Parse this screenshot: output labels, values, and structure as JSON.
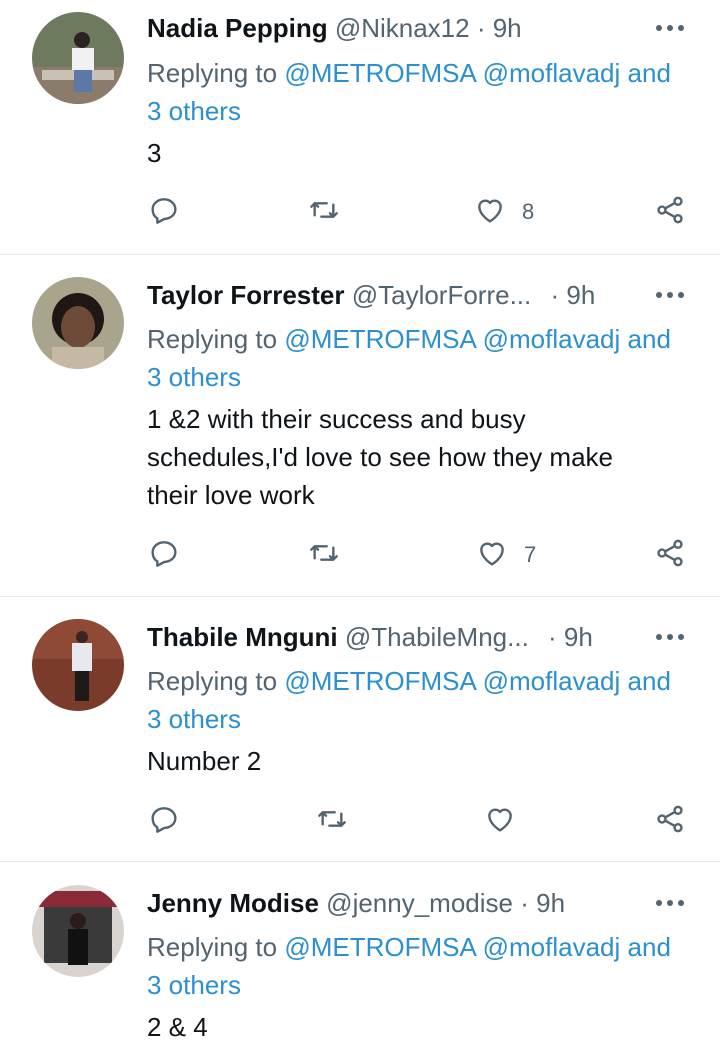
{
  "replies": [
    {
      "name": "Nadia Pepping",
      "handle": "@Niknax12",
      "time": "· 9h",
      "replying_prefix": "Replying to",
      "mention1": "@METROFMSA",
      "mention2": "@moflavadj",
      "others": "and 3 others",
      "text": "3",
      "like_count": "8"
    },
    {
      "name": "Taylor Forrester",
      "handle": "@TaylorForre...",
      "time": "· 9h",
      "replying_prefix": "Replying to",
      "mention1": "@METROFMSA",
      "mention2": "@moflavadj",
      "others": "and 3 others",
      "text": "1 &2 with their success and busy schedules,I'd love to see how they make their love work",
      "like_count": "7"
    },
    {
      "name": "Thabile Mnguni",
      "handle": "@ThabileMng...",
      "time": "· 9h",
      "replying_prefix": "Replying to",
      "mention1": "@METROFMSA",
      "mention2": "@moflavadj",
      "others": "and 3 others",
      "text": "Number 2",
      "like_count": ""
    },
    {
      "name": "Jenny Modise",
      "handle": "@jenny_modise",
      "time": "· 9h",
      "replying_prefix": "Replying to",
      "mention1": "@METROFMSA",
      "mention2": "@moflavadj",
      "others": "and 3 others",
      "text": "2 & 4",
      "like_count": ""
    }
  ],
  "icons": {
    "reply": "reply-icon",
    "retweet": "retweet-icon",
    "like": "heart-icon",
    "share": "share-icon",
    "more": "more-options-icon"
  },
  "colors": {
    "link": "#2b8fd0",
    "secondary_text": "#536471",
    "primary_text": "#0f1419",
    "divider": "#e6e9eb"
  }
}
